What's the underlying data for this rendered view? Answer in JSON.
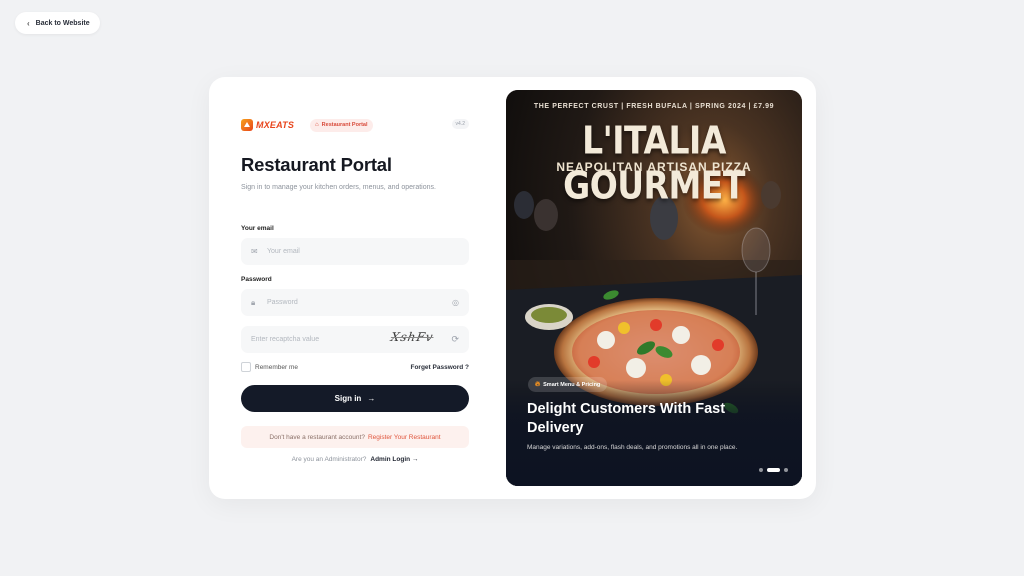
{
  "back_button": {
    "label": "Back to Website",
    "icon": "chevron-left-icon"
  },
  "brand": {
    "logo_text": "MXEATS",
    "portal_badge": "Restaurant Portal",
    "version": "v4.2"
  },
  "login": {
    "title": "Restaurant Portal",
    "subtitle": "Sign in to manage your kitchen orders, menus, and operations.",
    "email_label": "Your email",
    "email_placeholder": "Your email",
    "password_label": "Password",
    "password_placeholder": "Password",
    "captcha_placeholder": "Enter recaptcha value",
    "captcha_text": "XshFv",
    "remember_label": "Remember me",
    "forgot_label": "Forget Password ?",
    "signin_label": "Sign in",
    "signin_arrow": "→",
    "register_prompt": "Don't have a restaurant account?",
    "register_link": "Register Your Restaurant",
    "admin_prompt": "Are you an Administrator?",
    "admin_link": "Admin Login →"
  },
  "promo": {
    "tagline": "THE PERFECT CRUST | FRESH BUFALA | SPRING 2024 | £7.99",
    "title": "L'ITALIA GOURMET",
    "subtitle": "NEAPOLITAN ARTISAN PIZZA",
    "badge": "Smart Menu & Pricing",
    "headline": "Delight Customers With Fast Delivery",
    "description": "Manage variations, add-ons, flash deals, and promotions all in one place.",
    "slides": 3,
    "active_slide": 2
  },
  "colors": {
    "page_bg": "#f1f2f4",
    "brand_orange": "#e8451c",
    "button_dark": "#141a28",
    "register_link": "#e0563d"
  }
}
